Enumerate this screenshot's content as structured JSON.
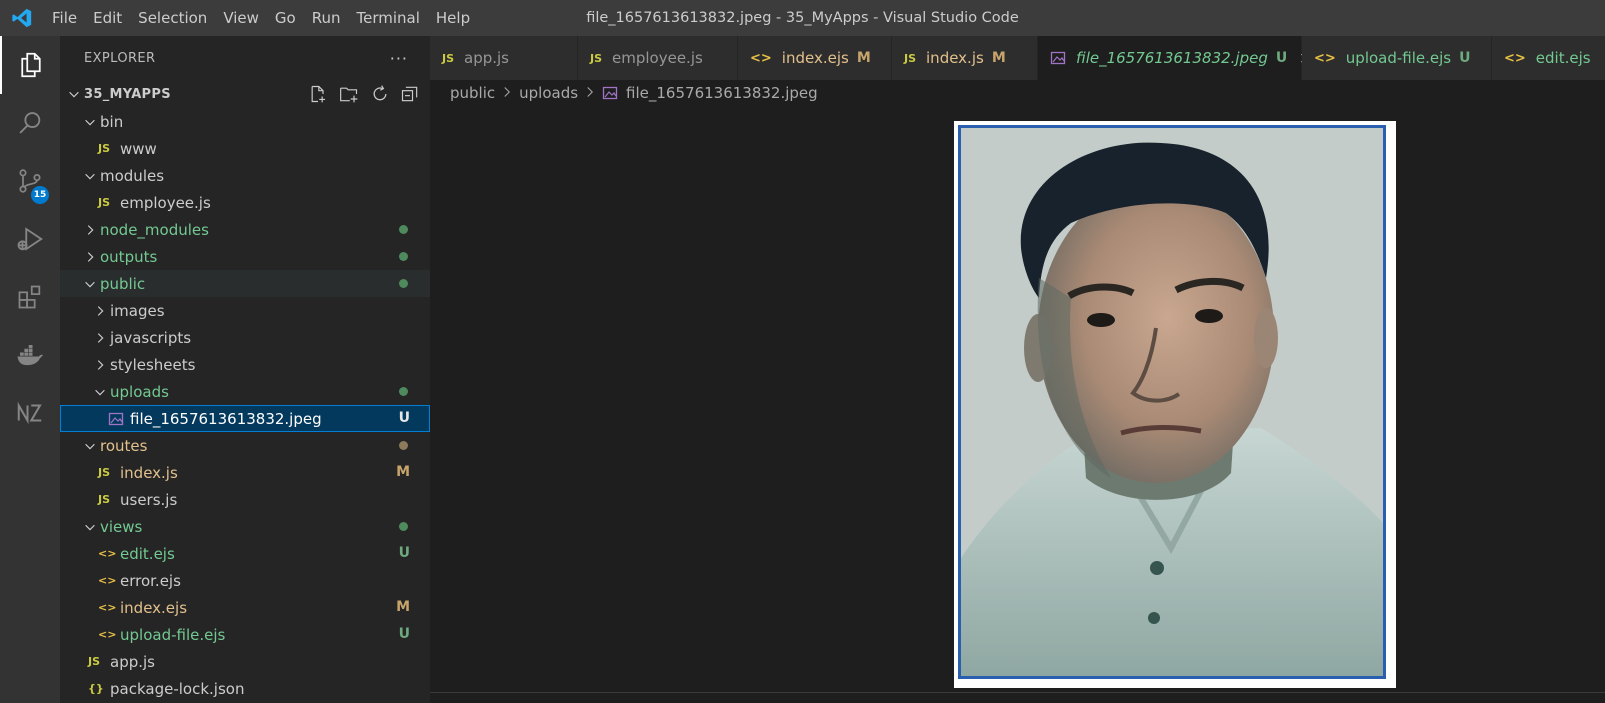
{
  "window": {
    "title": "file_1657613613832.jpeg - 35_MyApps - Visual Studio Code",
    "menu": [
      "File",
      "Edit",
      "Selection",
      "View",
      "Go",
      "Run",
      "Terminal",
      "Help"
    ]
  },
  "activity_bar": {
    "items": [
      "files-icon",
      "search-icon",
      "source-control-icon",
      "run-debug-icon",
      "extensions-icon",
      "docker-icon",
      "nx-icon"
    ],
    "source_control_badge": "15"
  },
  "sidebar": {
    "title": "EXPLORER",
    "more": "···",
    "folder": "35_MYAPPS",
    "tree": [
      {
        "label": "bin",
        "kind": "folder",
        "expanded": true,
        "depth": 0
      },
      {
        "label": "www",
        "kind": "file",
        "icon": "JS",
        "depth": 1
      },
      {
        "label": "modules",
        "kind": "folder",
        "expanded": true,
        "depth": 0
      },
      {
        "label": "employee.js",
        "kind": "file",
        "icon": "JS",
        "depth": 1
      },
      {
        "label": "node_modules",
        "kind": "folder",
        "expanded": false,
        "depth": 0,
        "color": "green",
        "dot": "#4f8a5d"
      },
      {
        "label": "outputs",
        "kind": "folder",
        "expanded": false,
        "depth": 0,
        "color": "green",
        "dot": "#4f8a5d"
      },
      {
        "label": "public",
        "kind": "folder",
        "expanded": true,
        "depth": 0,
        "color": "green",
        "dot": "#4f8a5d"
      },
      {
        "label": "images",
        "kind": "folder",
        "expanded": false,
        "depth": 1
      },
      {
        "label": "javascripts",
        "kind": "folder",
        "expanded": false,
        "depth": 1
      },
      {
        "label": "stylesheets",
        "kind": "folder",
        "expanded": false,
        "depth": 1
      },
      {
        "label": "uploads",
        "kind": "folder",
        "expanded": true,
        "depth": 1,
        "color": "green",
        "dot": "#4f8a5d"
      },
      {
        "label": "file_1657613613832.jpeg",
        "kind": "file",
        "icon": "image",
        "depth": 2,
        "status": "U",
        "selected": true
      },
      {
        "label": "routes",
        "kind": "folder",
        "expanded": true,
        "depth": 0,
        "color": "mod",
        "dot": "#8c7a5b"
      },
      {
        "label": "index.js",
        "kind": "file",
        "icon": "JS",
        "depth": 1,
        "color": "mod",
        "status": "M"
      },
      {
        "label": "users.js",
        "kind": "file",
        "icon": "JS",
        "depth": 1
      },
      {
        "label": "views",
        "kind": "folder",
        "expanded": true,
        "depth": 0,
        "color": "green",
        "dot": "#4f8a5d"
      },
      {
        "label": "edit.ejs",
        "kind": "file",
        "icon": "ejs",
        "depth": 1,
        "color": "green",
        "status": "U"
      },
      {
        "label": "error.ejs",
        "kind": "file",
        "icon": "ejs",
        "depth": 1
      },
      {
        "label": "index.ejs",
        "kind": "file",
        "icon": "ejs",
        "depth": 1,
        "color": "mod",
        "status": "M"
      },
      {
        "label": "upload-file.ejs",
        "kind": "file",
        "icon": "ejs",
        "depth": 1,
        "color": "green",
        "status": "U"
      },
      {
        "label": "app.js",
        "kind": "file",
        "icon": "JS",
        "depth": 0
      },
      {
        "label": "package-lock.json",
        "kind": "file",
        "icon": "json",
        "depth": 0
      }
    ]
  },
  "tabs": [
    {
      "label": "app.js",
      "icon": "JS",
      "width": 148
    },
    {
      "label": "employee.js",
      "icon": "JS",
      "width": 160
    },
    {
      "label": "index.ejs",
      "icon": "ejs",
      "status": "M",
      "color": "mod",
      "width": 154
    },
    {
      "label": "index.js",
      "icon": "JS",
      "status": "M",
      "color": "mod",
      "width": 146
    },
    {
      "label": "file_1657613613832.jpeg",
      "icon": "image",
      "status": "U",
      "active": true,
      "width": 264
    },
    {
      "label": "upload-file.ejs",
      "icon": "ejs",
      "status": "U",
      "color": "green",
      "width": 190
    },
    {
      "label": "edit.ejs",
      "icon": "ejs",
      "color": "green",
      "width": 120
    }
  ],
  "breadcrumb": [
    "public",
    "uploads",
    "file_1657613613832.jpeg"
  ],
  "icons": {
    "js_text": "JS",
    "ejs_text": "<>",
    "json_text": "{}"
  },
  "colors": {
    "accent": "#007acc",
    "untracked": "#73c991",
    "modified": "#e2c08d",
    "js_icon": "#cbcb41"
  }
}
